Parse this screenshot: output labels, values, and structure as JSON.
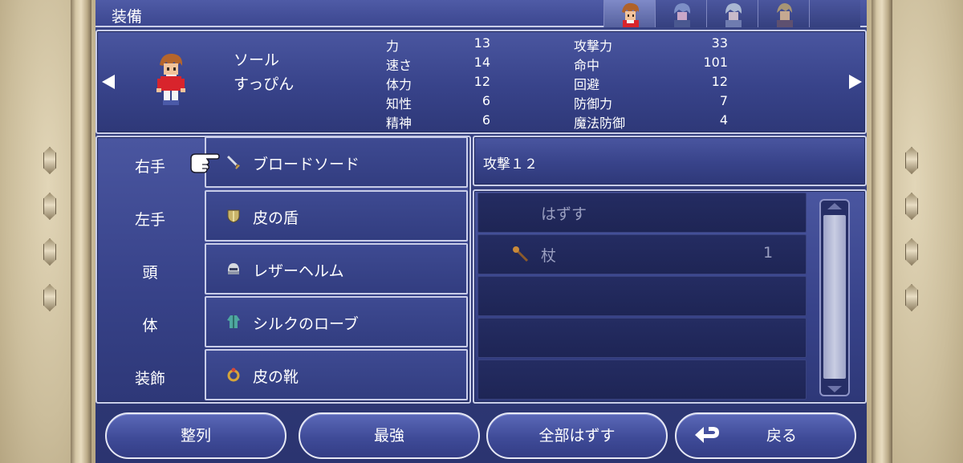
{
  "header": {
    "title": "装備",
    "party_tabs": [
      "party-member-1",
      "party-member-2",
      "party-member-3",
      "party-member-4"
    ],
    "active_tab": 0
  },
  "character": {
    "name": "ソール",
    "job": "すっぴん",
    "stats_left": [
      {
        "label": "力",
        "value": "13"
      },
      {
        "label": "速さ",
        "value": "14"
      },
      {
        "label": "体力",
        "value": "12"
      },
      {
        "label": "知性",
        "value": "6"
      },
      {
        "label": "精神",
        "value": "6"
      }
    ],
    "stats_right": [
      {
        "label": "攻撃力",
        "value": "33"
      },
      {
        "label": "命中",
        "value": "101"
      },
      {
        "label": "回避",
        "value": "12"
      },
      {
        "label": "防御力",
        "value": "7"
      },
      {
        "label": "魔法防御",
        "value": "4"
      }
    ]
  },
  "equipment": {
    "slots": [
      {
        "label": "右手",
        "item": "ブロードソード",
        "icon": "sword-icon"
      },
      {
        "label": "左手",
        "item": "皮の盾",
        "icon": "shield-icon"
      },
      {
        "label": "頭",
        "item": "レザーヘルム",
        "icon": "helmet-icon"
      },
      {
        "label": "体",
        "item": "シルクのローブ",
        "icon": "robe-icon"
      },
      {
        "label": "装飾",
        "item": "皮の靴",
        "icon": "ring-icon"
      }
    ]
  },
  "info": {
    "description": "攻撃１２"
  },
  "item_list": {
    "remove_label": "はずす",
    "items": [
      {
        "name": "杖",
        "count": "1",
        "icon": "staff-icon"
      }
    ]
  },
  "buttons": {
    "sort": "整列",
    "optimal": "最強",
    "remove_all": "全部はずす",
    "back": "戻る"
  },
  "colors": {
    "panel": "#3c4790",
    "border": "#c9cde8",
    "dimmed_text": "#9a9fc0"
  }
}
